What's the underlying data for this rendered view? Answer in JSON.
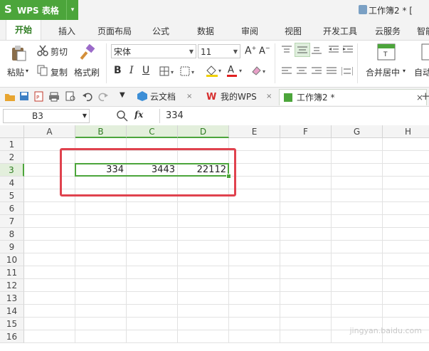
{
  "app": {
    "logo_glyph": "S",
    "name": "WPS 表格",
    "menu_arrow": "▾",
    "doc_title": "工作簿2 * ["
  },
  "ribbon_tabs": [
    "开始",
    "插入",
    "页面布局",
    "公式",
    "数据",
    "审阅",
    "视图",
    "开发工具",
    "云服务",
    "智能"
  ],
  "ribbon": {
    "paste": "粘贴",
    "cut": "剪切",
    "copy": "复制",
    "format_painter": "格式刷",
    "font_name": "宋体",
    "font_size": "11",
    "bold": "B",
    "italic": "I",
    "underline": "U",
    "merge_center": "合并居中",
    "auto_wrap": "自动"
  },
  "doc_tabs": {
    "cloud": "云文档",
    "mywps": "我的WPS",
    "workbook": "工作簿2 *"
  },
  "formula_bar": {
    "cell_ref": "B3",
    "fx": "fx",
    "value": "334"
  },
  "columns": [
    "A",
    "B",
    "C",
    "D",
    "E",
    "F",
    "G",
    "H"
  ],
  "rows": [
    "1",
    "2",
    "3",
    "4",
    "5",
    "6",
    "7",
    "8",
    "9",
    "10",
    "11",
    "12",
    "13",
    "14",
    "15",
    "16"
  ],
  "cells": {
    "B3": "334",
    "C3": "3443",
    "D3": "22112"
  },
  "selected": {
    "cols": [
      "B",
      "C",
      "D"
    ],
    "row": "3"
  },
  "colors": {
    "accent": "#4ca53b",
    "highlight": "#e0424e"
  }
}
